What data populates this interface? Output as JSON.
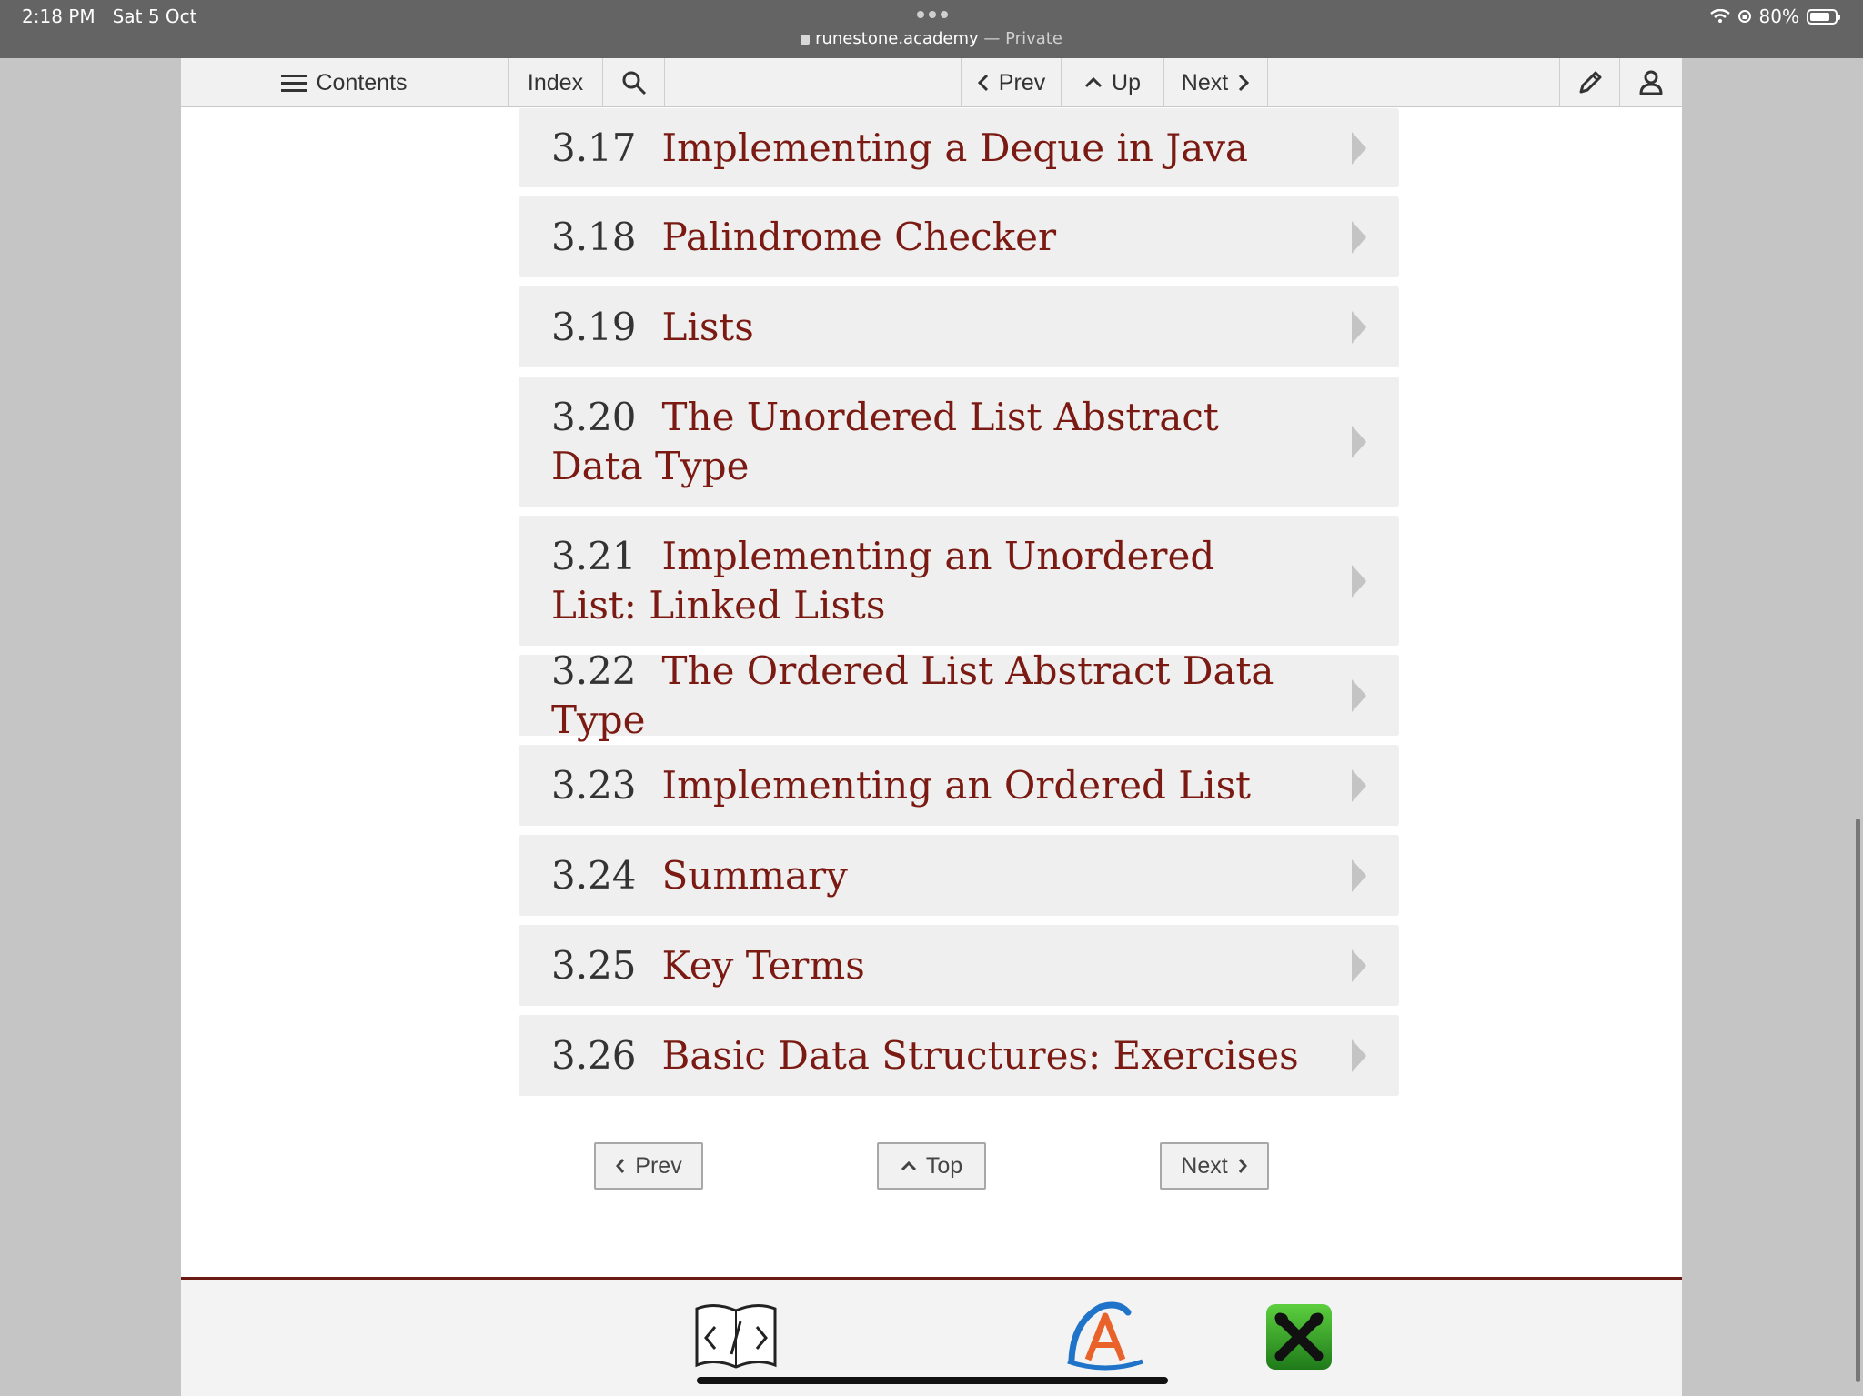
{
  "status": {
    "time": "2:18 PM",
    "date": "Sat 5 Oct",
    "url": "runestone.academy",
    "private_label": "— Private",
    "battery": "80%",
    "battery_level": 0.8
  },
  "toolbar": {
    "contents": "Contents",
    "index": "Index",
    "prev": "Prev",
    "up": "Up",
    "next": "Next"
  },
  "toc": [
    {
      "num": "3.17",
      "title": "Implementing a Deque in Java"
    },
    {
      "num": "3.18",
      "title": "Palindrome Checker"
    },
    {
      "num": "3.19",
      "title": "Lists"
    },
    {
      "num": "3.20",
      "title": "The Unordered List Abstract Data Type"
    },
    {
      "num": "3.21",
      "title": "Implementing an Unordered List: Linked Lists"
    },
    {
      "num": "3.22",
      "title": "The Ordered List Abstract Data Type"
    },
    {
      "num": "3.23",
      "title": "Implementing an Ordered List"
    },
    {
      "num": "3.24",
      "title": "Summary"
    },
    {
      "num": "3.25",
      "title": "Key Terms"
    },
    {
      "num": "3.26",
      "title": "Basic Data Structures: Exercises"
    }
  ],
  "bottom_nav": {
    "prev": "Prev",
    "top": "Top",
    "next": "Next"
  },
  "colors": {
    "link": "#7a1a12",
    "footer_rule": "#6a1a12"
  },
  "icons": [
    "menu-icon",
    "search-icon",
    "chevron-left-icon",
    "chevron-up-icon",
    "chevron-right-icon",
    "pencil-icon",
    "user-icon",
    "book-code-icon",
    "anaconda-icon",
    "app-icon"
  ]
}
